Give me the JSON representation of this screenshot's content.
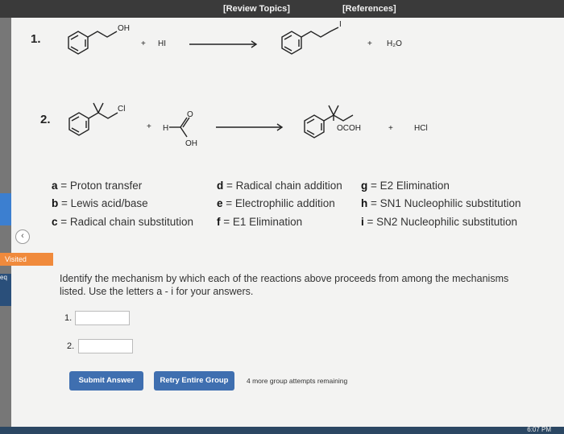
{
  "header": {
    "review_topics": "Review Topics",
    "references": "References"
  },
  "sidebar": {
    "visited_label": "Visited",
    "edge_text": "eq",
    "back_icon": "chevron-left-icon"
  },
  "reactions": [
    {
      "number": "1.",
      "reactant_label": "OH",
      "reagent": "HI",
      "product_label": "I",
      "byproduct": "H₂O",
      "plus": "+"
    },
    {
      "number": "2.",
      "reactant_label": "Cl",
      "reagent_h": "H",
      "reagent_o": "O",
      "reagent_oh": "OH",
      "product_label": "OCOH",
      "byproduct": "HCl",
      "plus": "+"
    }
  ],
  "legend": {
    "col1": [
      {
        "letter": "a",
        "text": " = Proton transfer"
      },
      {
        "letter": "b",
        "text": " = Lewis acid/base"
      },
      {
        "letter": "c",
        "text": " = Radical chain substitution"
      }
    ],
    "col2": [
      {
        "letter": "d",
        "text": " = Radical chain addition"
      },
      {
        "letter": "e",
        "text": " = Electrophilic addition"
      },
      {
        "letter": "f",
        "text": " = E1 Elimination"
      }
    ],
    "col3": [
      {
        "letter": "g",
        "text": " = E2 Elimination"
      },
      {
        "letter": "h",
        "text": " = SN1 Nucleophilic substitution"
      },
      {
        "letter": "i",
        "text": " = SN2 Nucleophilic substitution"
      }
    ]
  },
  "prompt": "Identify the mechanism by which each of the reactions above proceeds from among the mechanisms listed. Use the letters a - i for your answers.",
  "answers": [
    {
      "label": "1.",
      "value": ""
    },
    {
      "label": "2.",
      "value": ""
    }
  ],
  "buttons": {
    "submit": "Submit Answer",
    "retry": "Retry Entire Group"
  },
  "attempts_text": "4 more group attempts remaining",
  "clock": "6:07 PM",
  "colors": {
    "button": "#3f6fb0",
    "visited": "#f08a3c",
    "topbar": "#3a3a3a"
  }
}
